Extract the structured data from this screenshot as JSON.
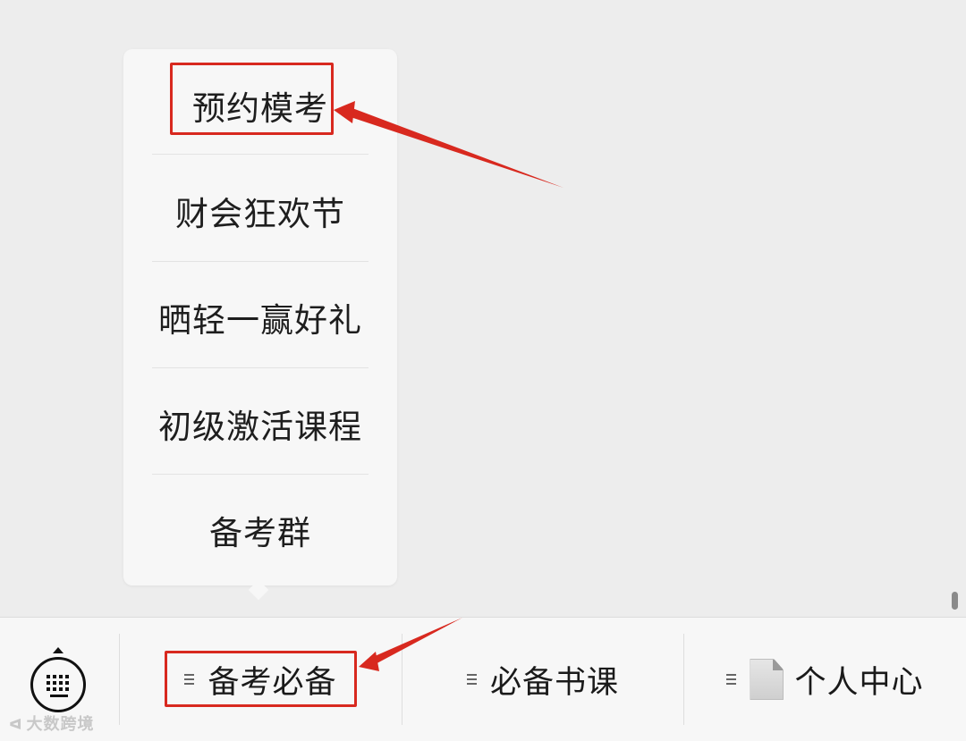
{
  "popup_menu": {
    "items": [
      {
        "label": "预约模考"
      },
      {
        "label": "财会狂欢节"
      },
      {
        "label": "晒轻一赢好礼"
      },
      {
        "label": "初级激活课程"
      },
      {
        "label": "备考群"
      }
    ]
  },
  "bottom_bar": {
    "keyboard_icon": "keyboard-icon",
    "tabs": [
      {
        "label": "备考必备",
        "icon": "menu-lines-icon"
      },
      {
        "label": "必备书课",
        "icon": "menu-lines-icon"
      },
      {
        "label": "个人中心",
        "icon": "document-icon"
      }
    ]
  },
  "annotations": {
    "highlight_color": "#d8291f"
  },
  "watermark": {
    "text": "大数跨境"
  }
}
